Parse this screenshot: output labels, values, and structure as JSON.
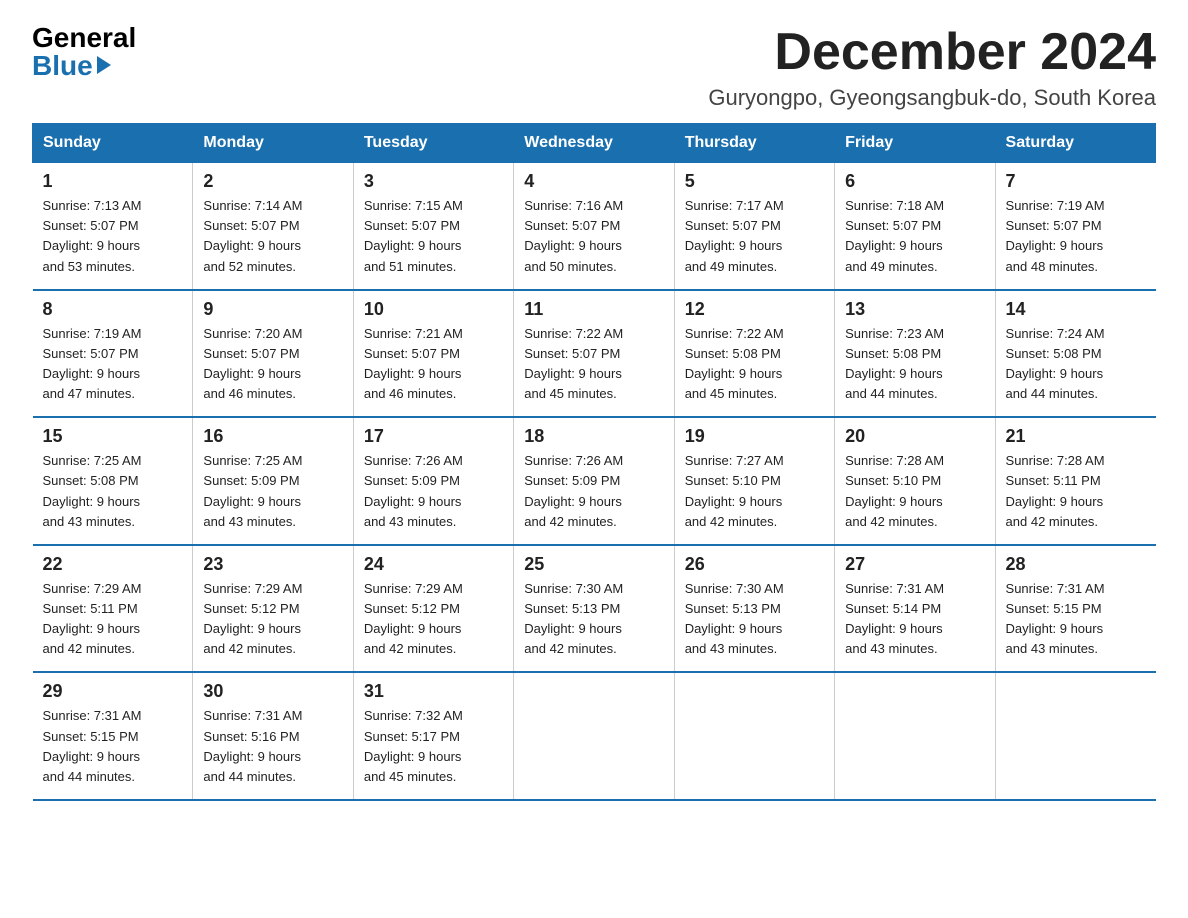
{
  "logo": {
    "general": "General",
    "blue": "Blue"
  },
  "title": "December 2024",
  "subtitle": "Guryongpo, Gyeongsangbuk-do, South Korea",
  "days_of_week": [
    "Sunday",
    "Monday",
    "Tuesday",
    "Wednesday",
    "Thursday",
    "Friday",
    "Saturday"
  ],
  "weeks": [
    [
      {
        "day": "1",
        "sunrise": "7:13 AM",
        "sunset": "5:07 PM",
        "daylight": "9 hours and 53 minutes."
      },
      {
        "day": "2",
        "sunrise": "7:14 AM",
        "sunset": "5:07 PM",
        "daylight": "9 hours and 52 minutes."
      },
      {
        "day": "3",
        "sunrise": "7:15 AM",
        "sunset": "5:07 PM",
        "daylight": "9 hours and 51 minutes."
      },
      {
        "day": "4",
        "sunrise": "7:16 AM",
        "sunset": "5:07 PM",
        "daylight": "9 hours and 50 minutes."
      },
      {
        "day": "5",
        "sunrise": "7:17 AM",
        "sunset": "5:07 PM",
        "daylight": "9 hours and 49 minutes."
      },
      {
        "day": "6",
        "sunrise": "7:18 AM",
        "sunset": "5:07 PM",
        "daylight": "9 hours and 49 minutes."
      },
      {
        "day": "7",
        "sunrise": "7:19 AM",
        "sunset": "5:07 PM",
        "daylight": "9 hours and 48 minutes."
      }
    ],
    [
      {
        "day": "8",
        "sunrise": "7:19 AM",
        "sunset": "5:07 PM",
        "daylight": "9 hours and 47 minutes."
      },
      {
        "day": "9",
        "sunrise": "7:20 AM",
        "sunset": "5:07 PM",
        "daylight": "9 hours and 46 minutes."
      },
      {
        "day": "10",
        "sunrise": "7:21 AM",
        "sunset": "5:07 PM",
        "daylight": "9 hours and 46 minutes."
      },
      {
        "day": "11",
        "sunrise": "7:22 AM",
        "sunset": "5:07 PM",
        "daylight": "9 hours and 45 minutes."
      },
      {
        "day": "12",
        "sunrise": "7:22 AM",
        "sunset": "5:08 PM",
        "daylight": "9 hours and 45 minutes."
      },
      {
        "day": "13",
        "sunrise": "7:23 AM",
        "sunset": "5:08 PM",
        "daylight": "9 hours and 44 minutes."
      },
      {
        "day": "14",
        "sunrise": "7:24 AM",
        "sunset": "5:08 PM",
        "daylight": "9 hours and 44 minutes."
      }
    ],
    [
      {
        "day": "15",
        "sunrise": "7:25 AM",
        "sunset": "5:08 PM",
        "daylight": "9 hours and 43 minutes."
      },
      {
        "day": "16",
        "sunrise": "7:25 AM",
        "sunset": "5:09 PM",
        "daylight": "9 hours and 43 minutes."
      },
      {
        "day": "17",
        "sunrise": "7:26 AM",
        "sunset": "5:09 PM",
        "daylight": "9 hours and 43 minutes."
      },
      {
        "day": "18",
        "sunrise": "7:26 AM",
        "sunset": "5:09 PM",
        "daylight": "9 hours and 42 minutes."
      },
      {
        "day": "19",
        "sunrise": "7:27 AM",
        "sunset": "5:10 PM",
        "daylight": "9 hours and 42 minutes."
      },
      {
        "day": "20",
        "sunrise": "7:28 AM",
        "sunset": "5:10 PM",
        "daylight": "9 hours and 42 minutes."
      },
      {
        "day": "21",
        "sunrise": "7:28 AM",
        "sunset": "5:11 PM",
        "daylight": "9 hours and 42 minutes."
      }
    ],
    [
      {
        "day": "22",
        "sunrise": "7:29 AM",
        "sunset": "5:11 PM",
        "daylight": "9 hours and 42 minutes."
      },
      {
        "day": "23",
        "sunrise": "7:29 AM",
        "sunset": "5:12 PM",
        "daylight": "9 hours and 42 minutes."
      },
      {
        "day": "24",
        "sunrise": "7:29 AM",
        "sunset": "5:12 PM",
        "daylight": "9 hours and 42 minutes."
      },
      {
        "day": "25",
        "sunrise": "7:30 AM",
        "sunset": "5:13 PM",
        "daylight": "9 hours and 42 minutes."
      },
      {
        "day": "26",
        "sunrise": "7:30 AM",
        "sunset": "5:13 PM",
        "daylight": "9 hours and 43 minutes."
      },
      {
        "day": "27",
        "sunrise": "7:31 AM",
        "sunset": "5:14 PM",
        "daylight": "9 hours and 43 minutes."
      },
      {
        "day": "28",
        "sunrise": "7:31 AM",
        "sunset": "5:15 PM",
        "daylight": "9 hours and 43 minutes."
      }
    ],
    [
      {
        "day": "29",
        "sunrise": "7:31 AM",
        "sunset": "5:15 PM",
        "daylight": "9 hours and 44 minutes."
      },
      {
        "day": "30",
        "sunrise": "7:31 AM",
        "sunset": "5:16 PM",
        "daylight": "9 hours and 44 minutes."
      },
      {
        "day": "31",
        "sunrise": "7:32 AM",
        "sunset": "5:17 PM",
        "daylight": "9 hours and 45 minutes."
      },
      null,
      null,
      null,
      null
    ]
  ]
}
